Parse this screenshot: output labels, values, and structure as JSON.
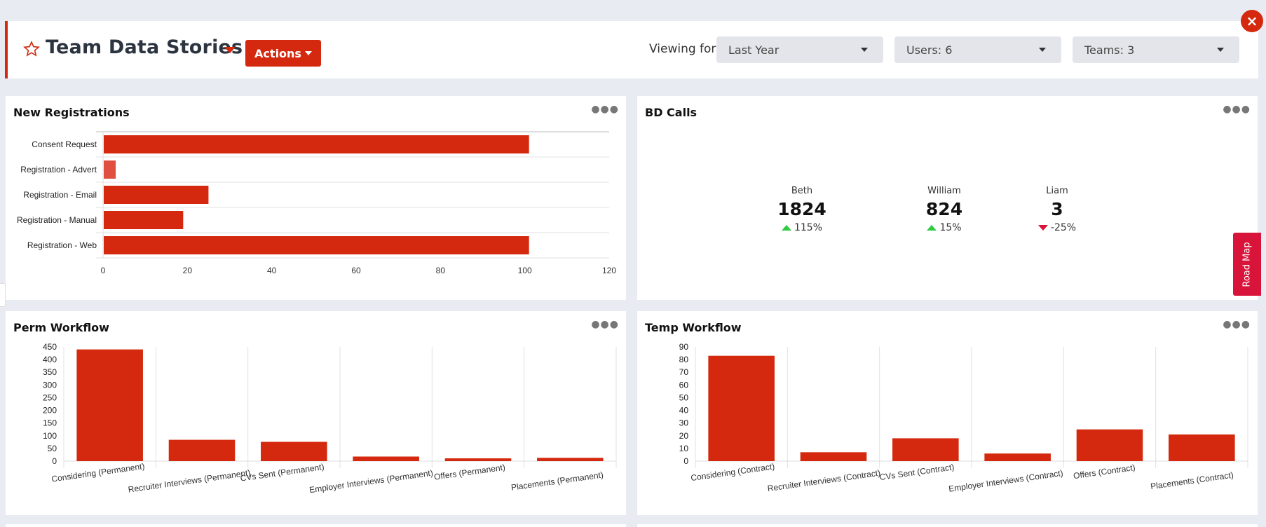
{
  "header": {
    "title": "Team Data Stories",
    "actions_label": "Actions",
    "viewing_label": "Viewing for:",
    "filters": [
      {
        "name": "period",
        "value": "Last Year"
      },
      {
        "name": "users",
        "value": "Users: 6"
      },
      {
        "name": "teams",
        "value": "Teams: 3"
      }
    ],
    "close_label": "×"
  },
  "colors": {
    "accent": "#d4290e",
    "bar": "#d4290e",
    "bar_light": "#e05040",
    "up": "#2ecc40",
    "down": "#d8143a"
  },
  "roadmap_label": "Road Map",
  "panels": {
    "new_registrations": {
      "title": "New Registrations"
    },
    "bd_calls": {
      "title": "BD Calls",
      "people": [
        {
          "name": "Beth",
          "value": "1824",
          "change": "115%",
          "direction": "up"
        },
        {
          "name": "William",
          "value": "824",
          "change": "15%",
          "direction": "up"
        },
        {
          "name": "Liam",
          "value": "3",
          "change": "-25%",
          "direction": "down"
        }
      ]
    },
    "perm_workflow": {
      "title": "Perm Workflow"
    },
    "temp_workflow": {
      "title": "Temp Workflow"
    }
  },
  "chart_data": [
    {
      "id": "new_registrations",
      "type": "bar",
      "orientation": "horizontal",
      "title": "New Registrations",
      "categories": [
        "Consent Request",
        "Registration - Advert",
        "Registration - Email",
        "Registration - Manual",
        "Registration - Web"
      ],
      "values": [
        101,
        3,
        25,
        19,
        101
      ],
      "xlim": [
        0,
        120
      ],
      "xticks": [
        0,
        20,
        40,
        60,
        80,
        100,
        120
      ],
      "grid": true
    },
    {
      "id": "perm_workflow",
      "type": "bar",
      "title": "Perm Workflow",
      "categories": [
        "Considering (Permanent)",
        "Recruiter Interviews (Permanent)",
        "CVs Sent (Permanent)",
        "Employer Interviews (Permanent)",
        "Offers (Permanent)",
        "Placements (Permanent)"
      ],
      "values": [
        440,
        84,
        76,
        18,
        11,
        13
      ],
      "ylim": [
        0,
        450
      ],
      "yticks": [
        0,
        50,
        100,
        150,
        200,
        250,
        300,
        350,
        400,
        450
      ],
      "grid": true
    },
    {
      "id": "temp_workflow",
      "type": "bar",
      "title": "Temp Workflow",
      "categories": [
        "Considering (Contract)",
        "Recruiter Interviews (Contract)",
        "CVs Sent (Contract)",
        "Employer Interviews (Contract)",
        "Offers (Contract)",
        "Placements (Contract)"
      ],
      "values": [
        83,
        7,
        18,
        6,
        25,
        21
      ],
      "ylim": [
        0,
        90
      ],
      "yticks": [
        0,
        10,
        20,
        30,
        40,
        50,
        60,
        70,
        80,
        90
      ],
      "grid": true
    }
  ]
}
